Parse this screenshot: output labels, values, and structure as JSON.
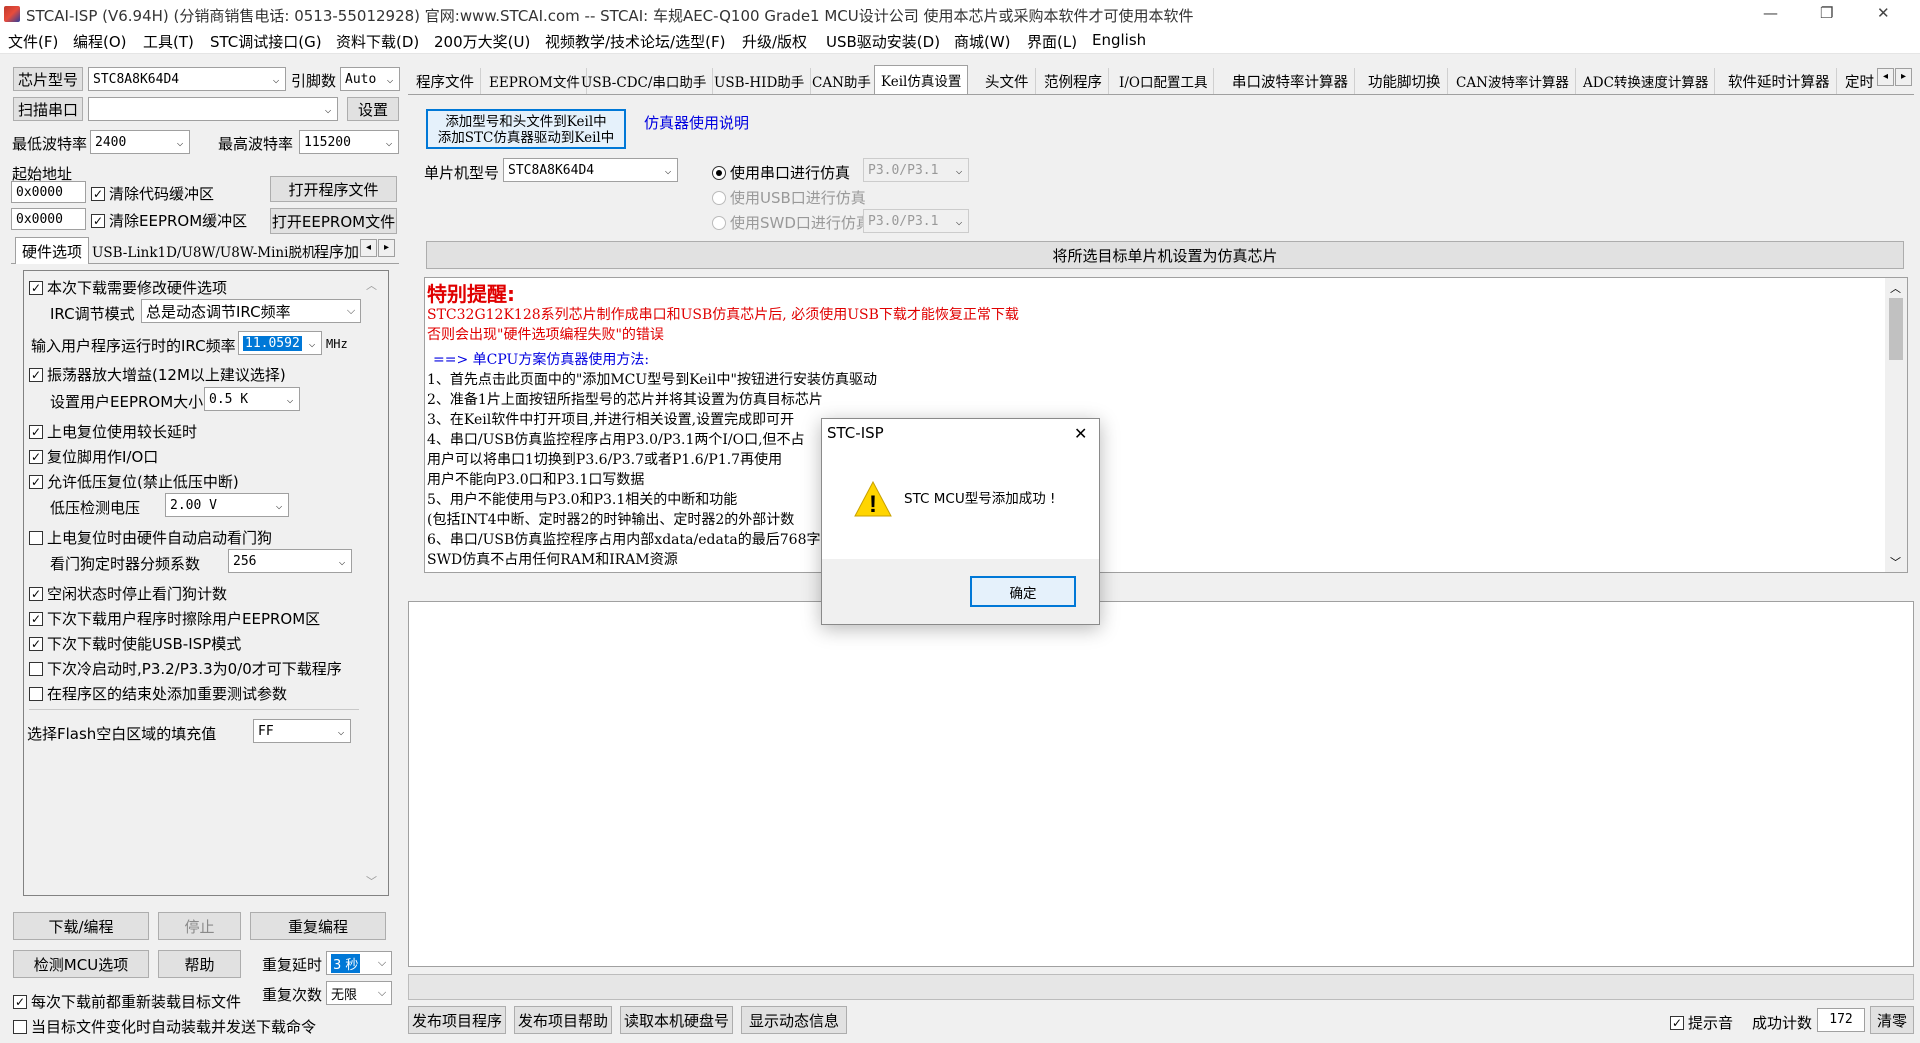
{
  "window": {
    "title": "STCAI-ISP (V6.94H) (分销商销售电话: 0513-55012928) 官网:www.STCAI.com  -- STCAI: 车规AEC-Q100 Grade1 MCU设计公司 使用本芯片或采购本软件才可使用本软件",
    "controls": {
      "minimize": "—",
      "restore": "❐",
      "close": "✕"
    }
  },
  "menu": [
    "文件(F)",
    "编程(O)",
    "工具(T)",
    "STC调试接口(G)",
    "资料下载(D)",
    "200万大奖(U)",
    "视频教学/技术论坛/选型(F)",
    "升级/版权",
    "USB驱动安装(D)",
    "商城(W)",
    "界面(L)",
    "English"
  ],
  "left": {
    "chip_model_btn": "芯片型号",
    "chip_model_value": "STC8A8K64D4",
    "pin_count_label": "引脚数",
    "pin_count_value": "Auto",
    "scan_port_btn": "扫描串口",
    "port_value": "",
    "settings_btn": "设置",
    "min_baud_label": "最低波特率",
    "min_baud_value": "2400",
    "max_baud_label": "最高波特率",
    "max_baud_value": "115200",
    "start_addr_label": "起始地址",
    "addr1": "0x0000",
    "clear_code_buf": "清除代码缓冲区",
    "open_program_btn": "打开程序文件",
    "addr2": "0x0000",
    "clear_eeprom_buf": "清除EEPROM缓冲区",
    "open_eeprom_btn": "打开EEPROM文件",
    "tabs": [
      "硬件选项",
      "USB-Link1D/U8W/U8W-Mini脱机",
      "程序加"
    ],
    "options": {
      "modify_hw": "本次下载需要修改硬件选项",
      "irc_mode_label": "IRC调节模式",
      "irc_mode_value": "总是动态调节IRC频率",
      "irc_freq_label": "输入用户程序运行时的IRC频率",
      "irc_freq_value": "11.0592",
      "irc_freq_unit": "MHz",
      "osc_gain": "振荡器放大增益(12M以上建议选择)",
      "eeprom_size_label": "设置用户EEPROM大小",
      "eeprom_size_value": "0.5 K",
      "power_reset_delay": "上电复位使用较长延时",
      "reset_pin_io": "复位脚用作I/O口",
      "low_volt_reset": "允许低压复位(禁止低压中断)",
      "low_volt_label": "低压检测电压",
      "low_volt_value": "2.00 V",
      "wdt_auto": "上电复位时由硬件自动启动看门狗",
      "wdt_div_label": "看门狗定时器分频系数",
      "wdt_div_value": "256",
      "idle_stop_wdt": "空闲状态时停止看门狗计数",
      "erase_eeprom": "下次下载用户程序时擦除用户EEPROM区",
      "usb_isp": "下次下载时使能USB-ISP模式",
      "cold_boot": "下次冷启动时,P3.2/P3.3为0/0才可下载程序",
      "add_test_params": "在程序区的结束处添加重要测试参数",
      "flash_fill_label": "选择Flash空白区域的填充值",
      "flash_fill_value": "FF"
    },
    "download_btn": "下载/编程",
    "stop_btn": "停止",
    "reprogram_btn": "重复编程",
    "detect_btn": "检测MCU选项",
    "help_btn": "帮助",
    "repeat_delay_label": "重复延时",
    "repeat_delay_value": "3 秒",
    "repeat_count_label": "重复次数",
    "repeat_count_value": "无限",
    "reload_each": "每次下载前都重新装载目标文件",
    "auto_send": "当目标文件变化时自动装载并发送下载命令"
  },
  "right_tabs": [
    "程序文件",
    "EEPROM文件",
    "USB-CDC/串口助手",
    "USB-HID助手",
    "CAN助手",
    "Keil仿真设置",
    "头文件",
    "范例程序",
    "I/O口配置工具",
    "串口波特率计算器",
    "功能脚切换",
    "CAN波特率计算器",
    "ADC转换速度计算器",
    "软件延时计算器",
    "定时"
  ],
  "keil": {
    "add_btn_line1": "添加型号和头文件到Keil中",
    "add_btn_line2": "添加STC仿真器驱动到Keil中",
    "sim_help_link": "仿真器使用说明",
    "mcu_label": "单片机型号",
    "mcu_value": "STC8A8K64D4",
    "radio_serial": "使用串口进行仿真",
    "radio_serial_pins": "P3.0/P3.1",
    "radio_usb": "使用USB口进行仿真",
    "radio_swd": "使用SWD口进行仿真",
    "radio_swd_pins": "P3.0/P3.1",
    "set_target_btn": "将所选目标单片机设置为仿真芯片",
    "notice_title": "特别提醒:",
    "notice_line1": "STC32G12K128系列芯片制作成串口和USB仿真芯片后, 必须使用USB下载才能恢复正常下载",
    "notice_line2": "否则会出现\"硬件选项编程失败\"的错误",
    "method_title": "==> 单CPU方案仿真器使用方法:",
    "steps": [
      "1、首先点击此页面中的\"添加MCU型号到Keil中\"按钮进行安装仿真驱动",
      "2、准备1片上面按钮所指型号的芯片并将其设置为仿真目标芯片",
      "3、在Keil软件中打开项目,并进行相关设置,设置完成即可开",
      "4、串口/USB仿真监控程序占用P3.0/P3.1两个I/O口,但不占",
      "    用户可以将串口1切换到P3.6/P3.7或者P1.6/P1.7再使用",
      "    用户不能向P3.0口和P3.1口写数据",
      "5、用户不能使用与P3.0和P3.1相关的中断和功能",
      "    (包括INT4中断、定时器2的时钟输出、定时器2的外部计数",
      "6、串口/USB仿真监控程序占用内部xdata/edata的最后768字",
      "    SWD仿真不占用任何RAM和IRAM资源"
    ]
  },
  "bottom": {
    "publish_btn": "发布项目程序",
    "publish_help_btn": "发布项目帮助",
    "read_disk_btn": "读取本机硬盘号",
    "show_dynamic_btn": "显示动态信息",
    "beep_label": "提示音",
    "success_label": "成功计数",
    "success_value": "172",
    "clear_btn": "清零"
  },
  "dialog": {
    "title": "STC-ISP",
    "message": "STC MCU型号添加成功 !",
    "ok_btn": "确定",
    "warning_glyph": "!"
  }
}
